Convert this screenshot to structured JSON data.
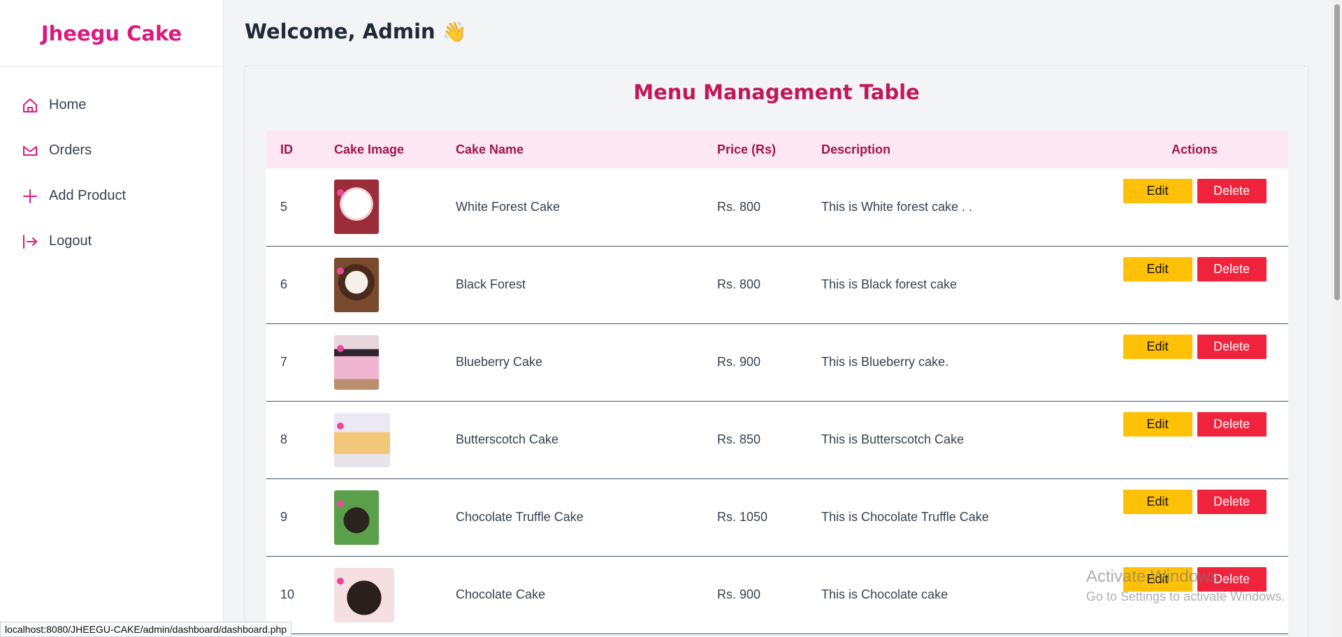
{
  "brand": "Jheegu Cake",
  "sidebar": {
    "items": [
      {
        "label": "Home",
        "icon": "home-icon"
      },
      {
        "label": "Orders",
        "icon": "orders-icon"
      },
      {
        "label": "Add Product",
        "icon": "plus-icon"
      },
      {
        "label": "Logout",
        "icon": "logout-icon"
      }
    ]
  },
  "header": {
    "welcome": "Welcome, Admin",
    "wave": "👋"
  },
  "table": {
    "title": "Menu Management Table",
    "columns": [
      "ID",
      "Cake Image",
      "Cake Name",
      "Price (Rs)",
      "Description",
      "Actions"
    ],
    "edit_label": "Edit",
    "delete_label": "Delete",
    "rows": [
      {
        "id": "5",
        "name": "White Forest Cake",
        "price": "Rs. 800",
        "description": "This is White forest cake . ."
      },
      {
        "id": "6",
        "name": "Black Forest",
        "price": "Rs. 800",
        "description": "This is Black forest cake"
      },
      {
        "id": "7",
        "name": "Blueberry Cake",
        "price": "Rs. 900",
        "description": "This is Blueberry cake."
      },
      {
        "id": "8",
        "name": "Butterscotch Cake",
        "price": "Rs. 850",
        "description": "This is Butterscotch Cake"
      },
      {
        "id": "9",
        "name": "Chocolate Truffle Cake",
        "price": "Rs. 1050",
        "description": "This is Chocolate Truffle Cake"
      },
      {
        "id": "10",
        "name": "Chocolate Cake",
        "price": "Rs. 900",
        "description": "This is Chocolate cake"
      }
    ]
  },
  "status_url": "localhost:8080/JHEEGU-CAKE/admin/dashboard/dashboard.php",
  "watermark": {
    "line1": "Activate Windows",
    "line2": "Go to Settings to activate Windows."
  },
  "colors": {
    "brand": "#db1a7d",
    "title": "#c2185b",
    "header_bg": "#fce7f3",
    "edit": "#ffc107",
    "delete": "#ef233c"
  }
}
